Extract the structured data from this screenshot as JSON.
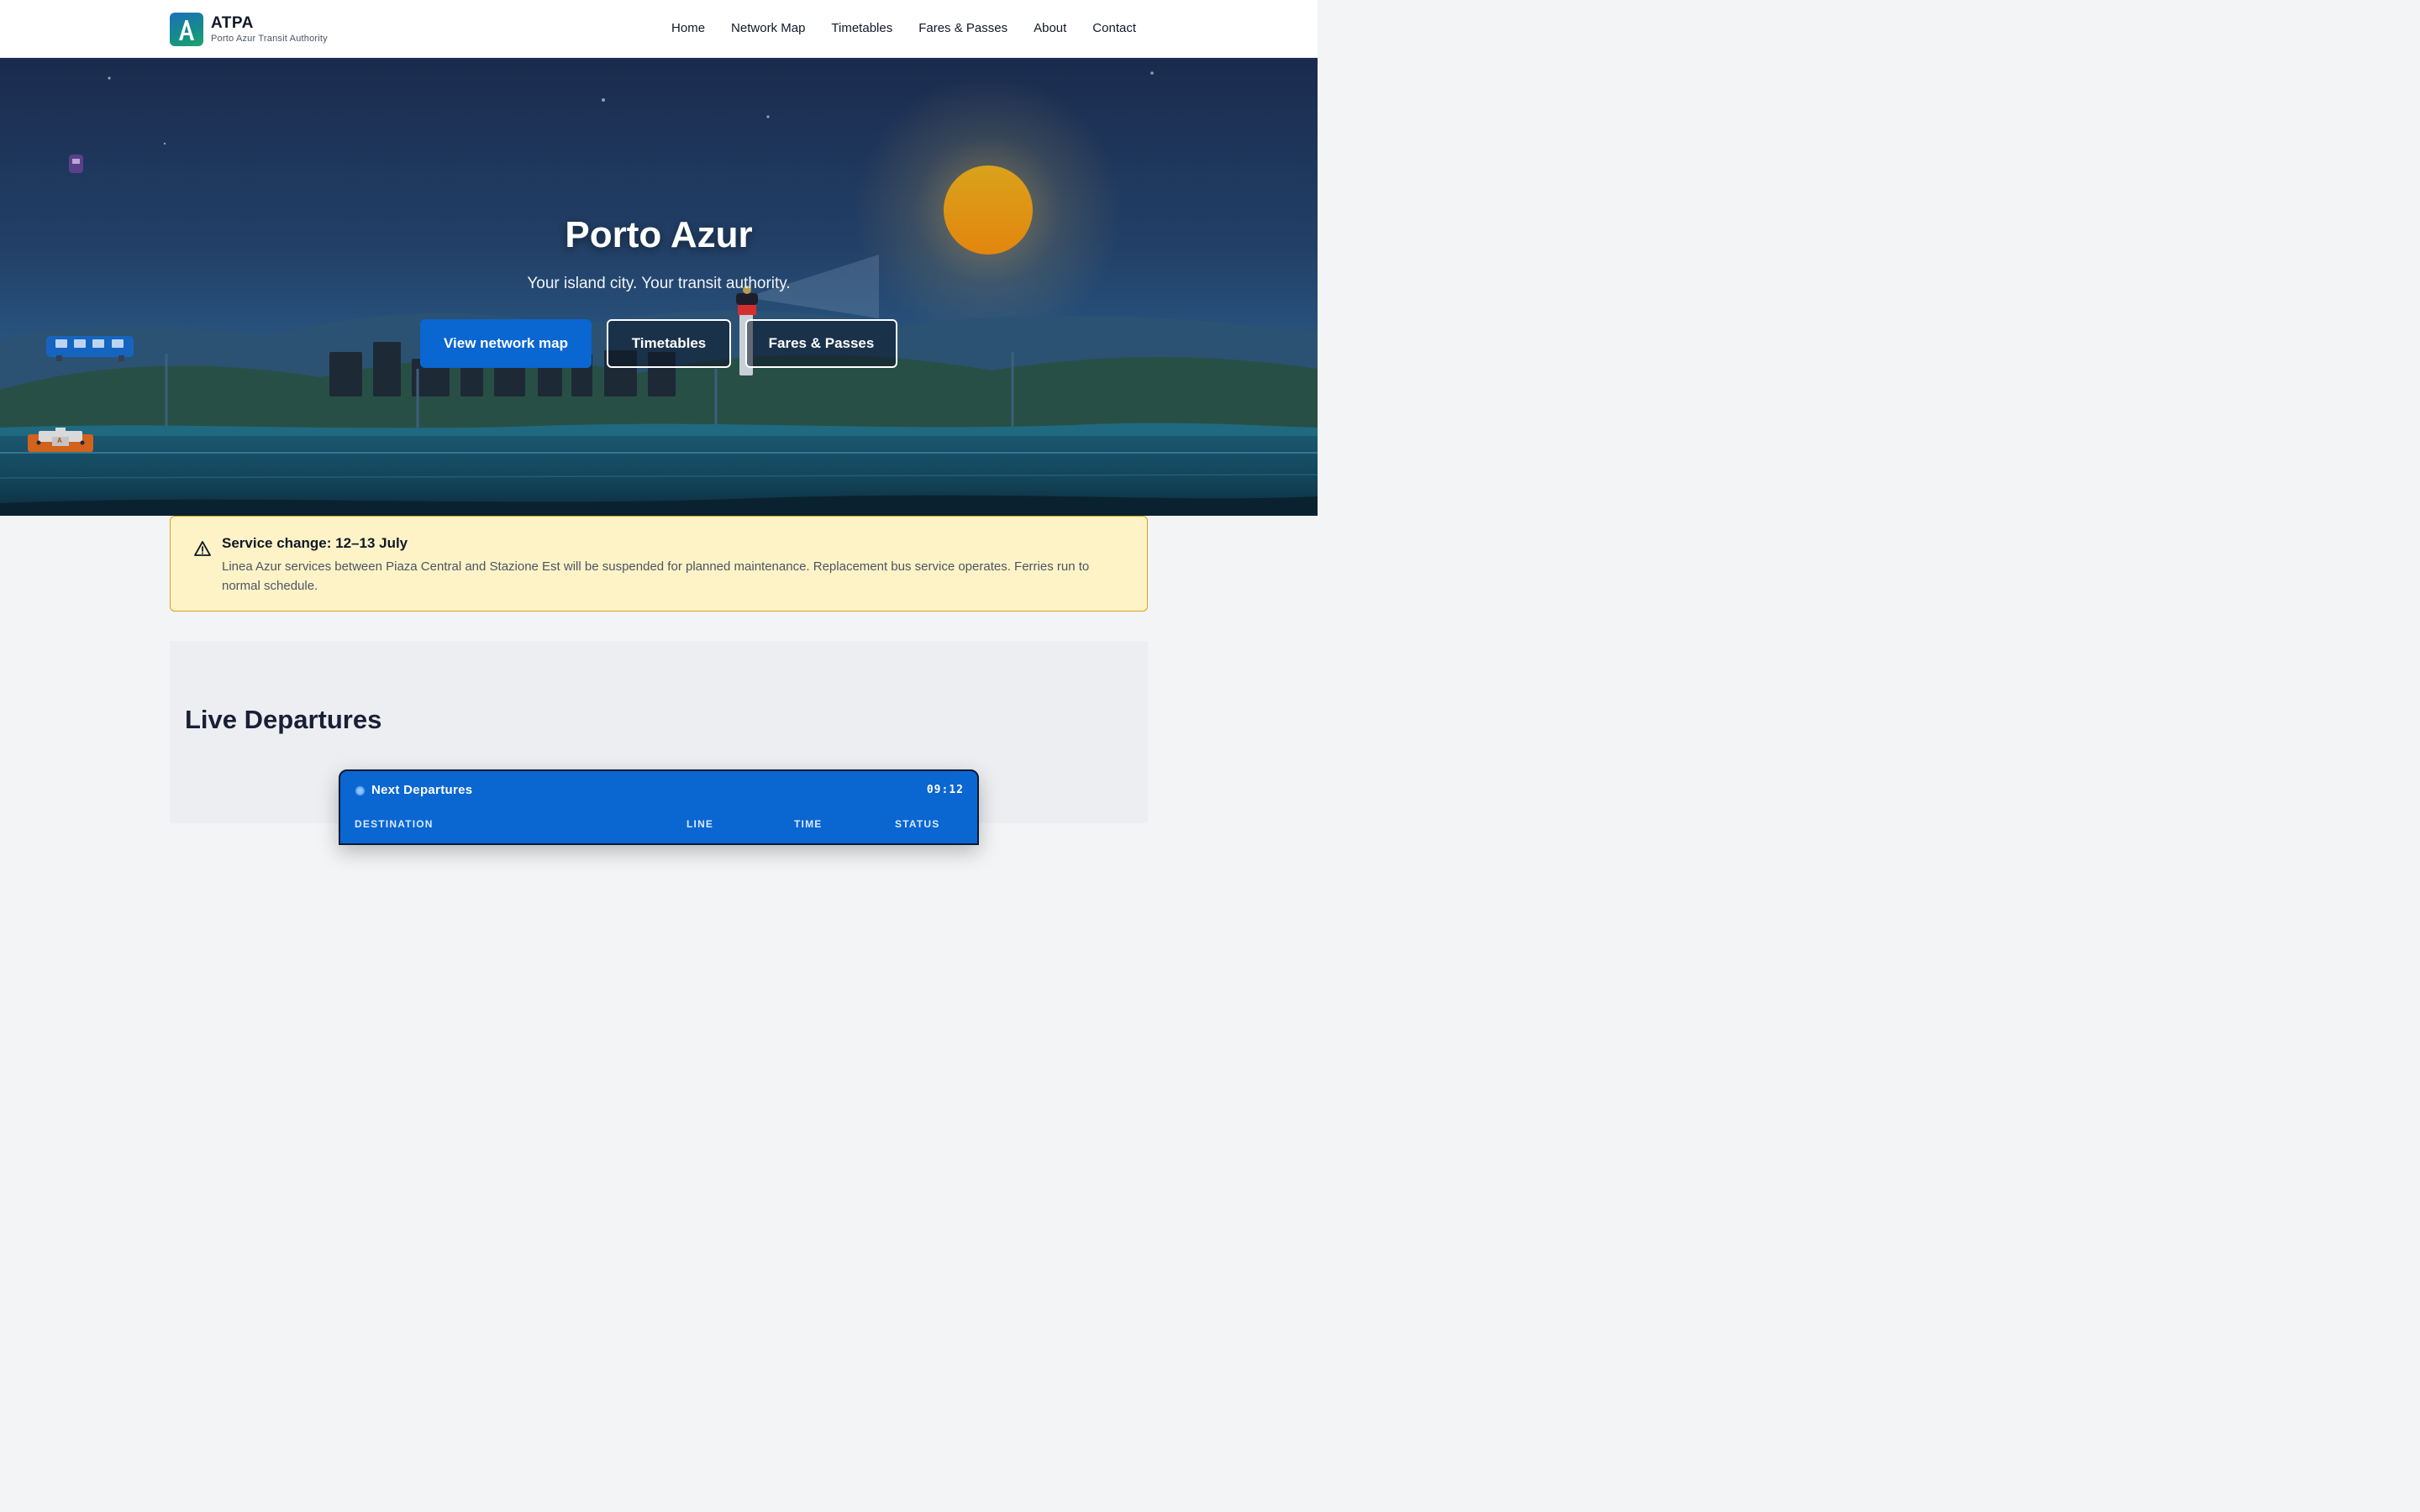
{
  "header": {
    "brand_name": "ATPA",
    "brand_subtitle": "Porto Azur Transit Authority",
    "nav": [
      {
        "label": "Home"
      },
      {
        "label": "Network Map"
      },
      {
        "label": "Timetables"
      },
      {
        "label": "Fares & Passes"
      },
      {
        "label": "About"
      },
      {
        "label": "Contact"
      }
    ]
  },
  "hero": {
    "title": "Porto Azur",
    "subtitle": "Your island city. Your transit authority.",
    "actions": [
      {
        "label": "View network map"
      },
      {
        "label": "Timetables"
      },
      {
        "label": "Fares & Passes"
      }
    ],
    "ferry_badge": "A"
  },
  "alert": {
    "icon": "warning-icon",
    "title": "Service change: 12–13 July",
    "body": "Linea Azur services between Piaza Central and Stazione Est will be suspended for planned maintenance. Replacement bus service operates. Ferries run to normal schedule."
  },
  "departures": {
    "section_title": "Live Departures",
    "board_title": "Next Departures",
    "clock": "09:12",
    "columns": [
      "DESTINATION",
      "LINE",
      "TIME",
      "STATUS"
    ]
  },
  "colors": {
    "primary": "#0a66d1",
    "alert_bg": "#fef3c7",
    "alert_border": "#d9a21b",
    "sun": "#e39b12"
  }
}
